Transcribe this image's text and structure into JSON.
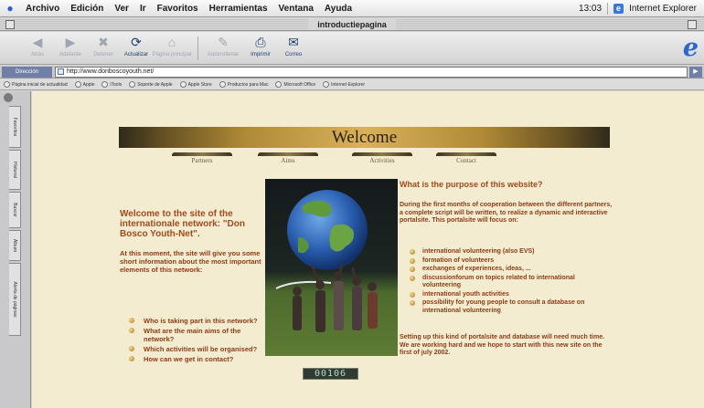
{
  "menubar": {
    "items": [
      "Archivo",
      "Edición",
      "Ver",
      "Ir",
      "Favoritos",
      "Herramientas",
      "Ventana",
      "Ayuda"
    ],
    "clock": "13:03",
    "app_name": "Internet Explorer"
  },
  "window": {
    "title": "introductiepagina"
  },
  "toolbar": {
    "back": "Atrás",
    "forward": "Adelante",
    "stop": "Detener",
    "refresh": "Actualizar",
    "home": "Página principal",
    "autofill": "Autorrellenar",
    "print": "Imprimir",
    "mail": "Correo"
  },
  "address": {
    "label": "Dirección",
    "url": "http://www.donboscoyouth.net/"
  },
  "favorites": [
    "Página inicial de actualidad",
    "Apple",
    "iTools",
    "Soporte de Apple",
    "Apple Store",
    "Productos para Mac",
    "Microsoft Office",
    "Internet Explorer"
  ],
  "sidebar_tabs": [
    "Favoritos",
    "Historial",
    "Buscar",
    "Álbum",
    "Alerta de páginas"
  ],
  "page": {
    "banner": "Welcome",
    "nav": [
      "Partners",
      "Aims",
      "Activities",
      "Contact"
    ],
    "intro_title": "Welcome to the site of the internationale network: \"Don Bosco Youth-Net\".",
    "intro_text": "At this moment, the site will give you some short information about the most important elements of this network:",
    "questions": [
      "Who is taking part in this network?",
      "What are the main aims of the network?",
      "Which activities will be organised?",
      "How can we get in contact?"
    ],
    "counter": "00106",
    "purpose_title": "What is the purpose of this website?",
    "purpose_text": "During the first months of cooperation between the different partners, a complete script will be written, to realize a dynamic and interactive portalsite. This portalsite will focus on:",
    "focus_items": [
      "international volunteering (also EVS)",
      "formation of volunteers",
      "exchanges of experiences, ideas, ...",
      "discussionforum on topics related to international volunteering",
      "international youth activities",
      "possibility for young people to consult a database on international volunteering"
    ],
    "closing_text": "Setting up this kind of portalsite and database will need much time. We are working hard and we hope to start with this new site on the first of july 2002."
  },
  "colors": {
    "page_background": "#f3ecd1",
    "heading": "#a24a1e",
    "body_text": "#8f3b15",
    "ie_blue": "#2f66c9"
  }
}
